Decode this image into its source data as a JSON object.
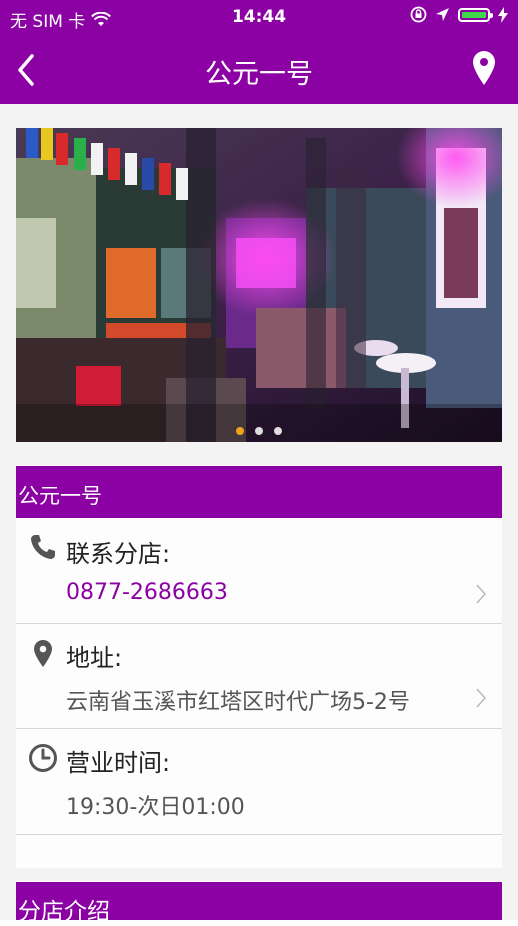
{
  "status_bar": {
    "carrier": "无 SIM 卡",
    "time": "14:44"
  },
  "nav": {
    "title": "公元一号",
    "back_icon": "chevron-left-icon",
    "location_icon": "map-pin-icon"
  },
  "banner": {
    "image": "bar-interior-photo",
    "page_count": 3,
    "active_page": 1
  },
  "store": {
    "name": "公元一号",
    "phone_label": "联系分店:",
    "phone": "0877-2686663",
    "address_label": "地址:",
    "address": "云南省玉溪市红塔区时代广场5-2号",
    "hours_label": "营业时间:",
    "hours": "19:30-次日01:00"
  },
  "intro": {
    "title": "分店介绍"
  },
  "colors": {
    "brand": "#8b01a3",
    "page_background": "#f4f3f4",
    "active_dot": "#f0a31c"
  }
}
